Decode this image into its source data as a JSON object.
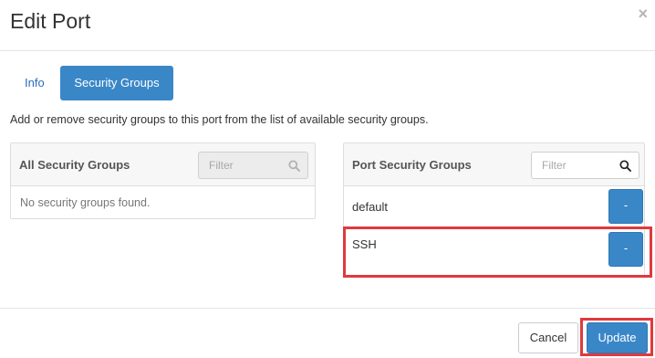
{
  "modal": {
    "title": "Edit Port",
    "close_symbol": "×"
  },
  "tabs": [
    {
      "label": "Info",
      "active": false
    },
    {
      "label": "Security Groups",
      "active": true
    }
  ],
  "description": "Add or remove security groups to this port from the list of available security groups.",
  "all_groups": {
    "title": "All Security Groups",
    "filter_placeholder": "Filter",
    "empty_text": "No security groups found."
  },
  "port_groups": {
    "title": "Port Security Groups",
    "filter_placeholder": "Filter",
    "items": [
      {
        "name": "default",
        "action": "-"
      },
      {
        "name": "SSH",
        "action": "-"
      }
    ]
  },
  "footer": {
    "cancel_label": "Cancel",
    "update_label": "Update"
  },
  "colors": {
    "primary": "#3a87c8",
    "link": "#2a6ebb",
    "highlight": "#e0393e"
  },
  "icons": {
    "filter_search": "search-icon",
    "close": "close-icon"
  }
}
